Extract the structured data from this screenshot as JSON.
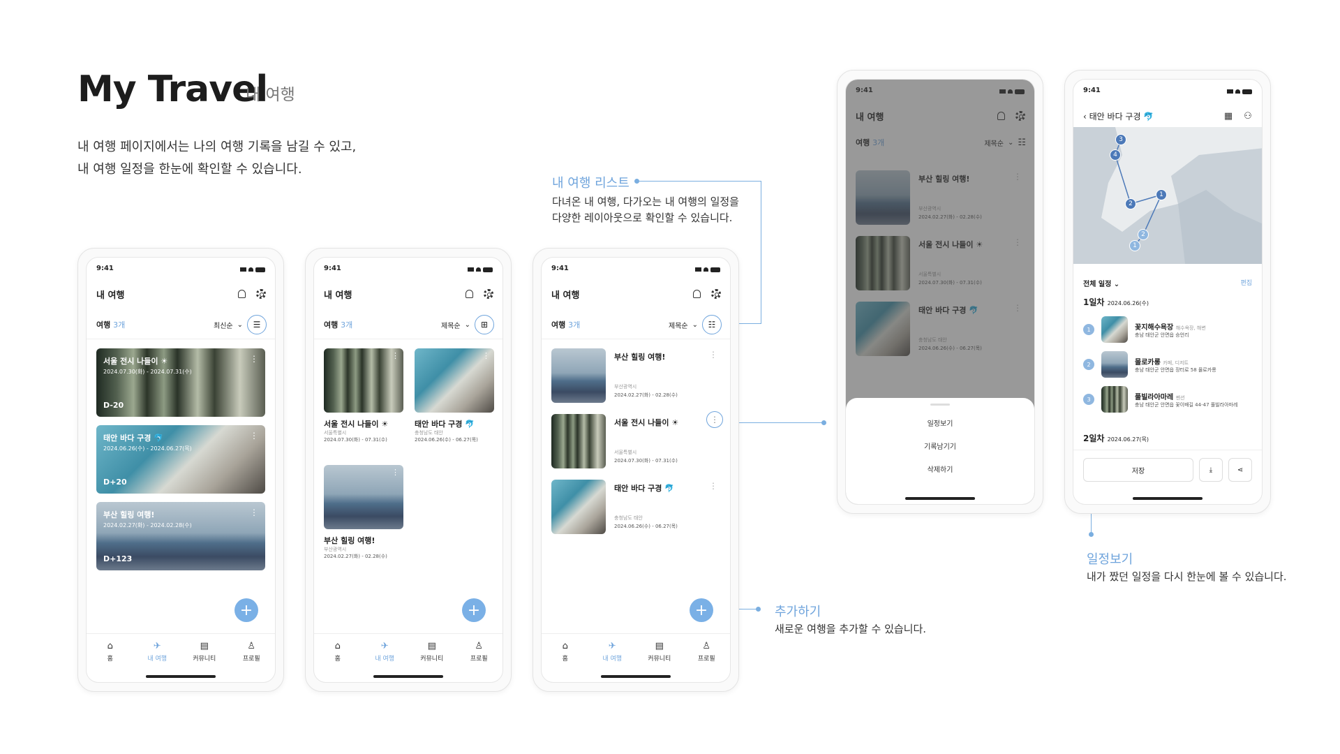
{
  "header": {
    "title": "My Travel",
    "subtitle": "내 여행",
    "desc": [
      "내 여행 페이지에서는 나의 여행 기록을 남길 수 있고,",
      "내 여행 일정을 한눈에 확인할 수 있습니다."
    ]
  },
  "annotations": {
    "list": {
      "title": "내 여행 리스트",
      "desc": [
        "다녀온 내 여행, 다가오는 내 여행의 일정을",
        "다양한 레이아웃으로 확인할 수 있습니다."
      ]
    },
    "add": {
      "title": "추가하기",
      "desc": "새로운 여행을 추가할 수 있습니다."
    },
    "schedule": {
      "title": "일정보기",
      "desc": "내가 짰던 일정을 다시 한눈에 볼 수 있습니다."
    }
  },
  "app": {
    "time": "9:41",
    "screen_title": "내 여행",
    "count_label": "여행",
    "count_value": "3개",
    "sort_latest": "최신순",
    "sort_title": "제목순",
    "fab": "+",
    "tabs": [
      {
        "label": "홈",
        "icon": "home-icon"
      },
      {
        "label": "내 여행",
        "icon": "plane-icon"
      },
      {
        "label": "커뮤니티",
        "icon": "community-icon"
      },
      {
        "label": "프로필",
        "icon": "profile-icon"
      }
    ],
    "trips": [
      {
        "title": "서울 전시 나들이",
        "emoji": "☀",
        "addr": "서울특별시",
        "date": "2024.07.30(화) - 07.31(수)",
        "date_long": "2024.07.30(화) - 2024.07.31(수)",
        "dday": "D-20"
      },
      {
        "title": "태안 바다 구경",
        "emoji": "🐬",
        "addr": "충청남도 태안",
        "date": "2024.06.26(수) - 06.27(목)",
        "date_long": "2024.06.26(수) - 2024.06.27(목)",
        "dday": "D+20"
      },
      {
        "title": "부산 힐링 여행!",
        "emoji": "",
        "addr": "부산광역시",
        "date": "2024.02.27(화) - 02.28(수)",
        "date_long": "2024.02.27(화) - 2024.02.28(수)",
        "dday": "D+123"
      }
    ],
    "sheet_items": [
      "일정보기",
      "기록남기기",
      "삭제하기"
    ],
    "detail": {
      "title": "태안 바다 구경",
      "filter": "전체 일정",
      "edit": "편집",
      "day1": "1일차",
      "day1_date": "2024.06.26(수)",
      "day2": "2일차",
      "day2_date": "2024.06.27(목)",
      "places": [
        {
          "num": "1",
          "name": "꽃지해수욕장",
          "cat": "해수욕장, 해변",
          "addr": "충남 태안군 안면읍 승언리"
        },
        {
          "num": "2",
          "name": "몰로카롱",
          "cat": "카페, 디저트",
          "addr": "충남 태안군 안면읍 장터로 58 몰로카롱"
        },
        {
          "num": "3",
          "name": "풀빌라아마레",
          "cat": "펜션",
          "addr": "충남 태안군 안면읍 꽃이배길 44-47 풀빌라아마레"
        }
      ],
      "save": "저장",
      "map_pins": [
        "3",
        "4",
        "2",
        "1",
        "2",
        "1"
      ]
    }
  }
}
